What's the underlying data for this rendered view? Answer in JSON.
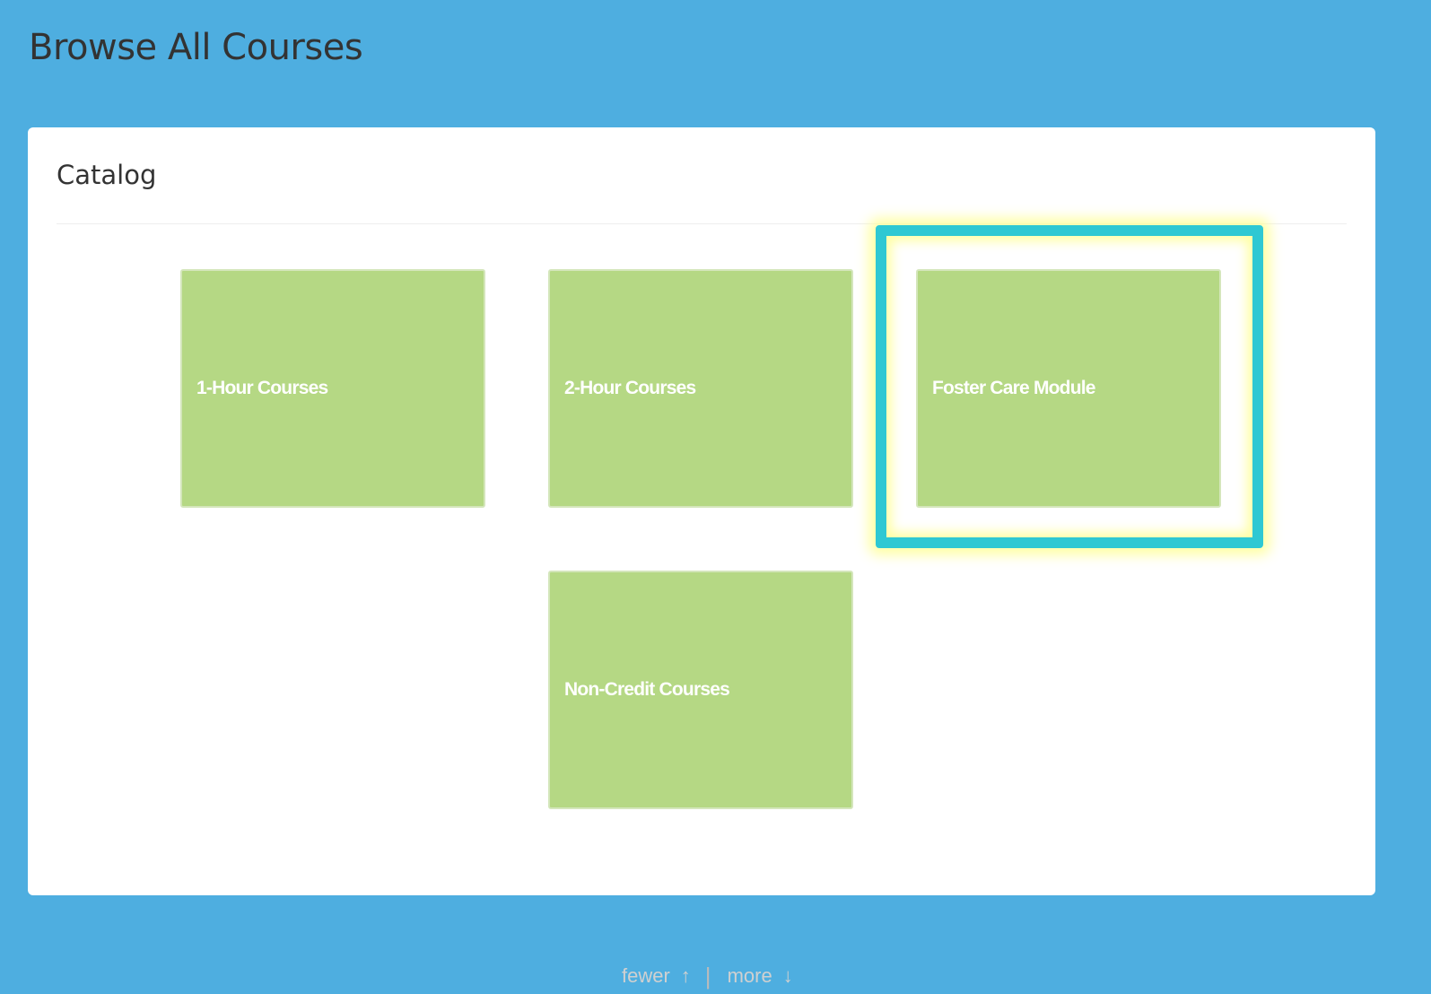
{
  "header": {
    "title": "Browse All Courses"
  },
  "catalog": {
    "heading": "Catalog",
    "tiles": [
      {
        "label": "1-Hour Courses"
      },
      {
        "label": "2-Hour Courses"
      },
      {
        "label": "Foster Care Module",
        "highlighted": true
      },
      {
        "label": "Non-Credit Courses"
      }
    ],
    "pager": {
      "fewer_label": "fewer",
      "fewer_icon": "↑",
      "separator": "|",
      "more_label": "more",
      "more_icon": "↓"
    }
  },
  "colors": {
    "background": "#4eaee0",
    "tile": "#b5d884",
    "highlight_border": "#2ec8d3",
    "highlight_glow": "#ffff96"
  }
}
